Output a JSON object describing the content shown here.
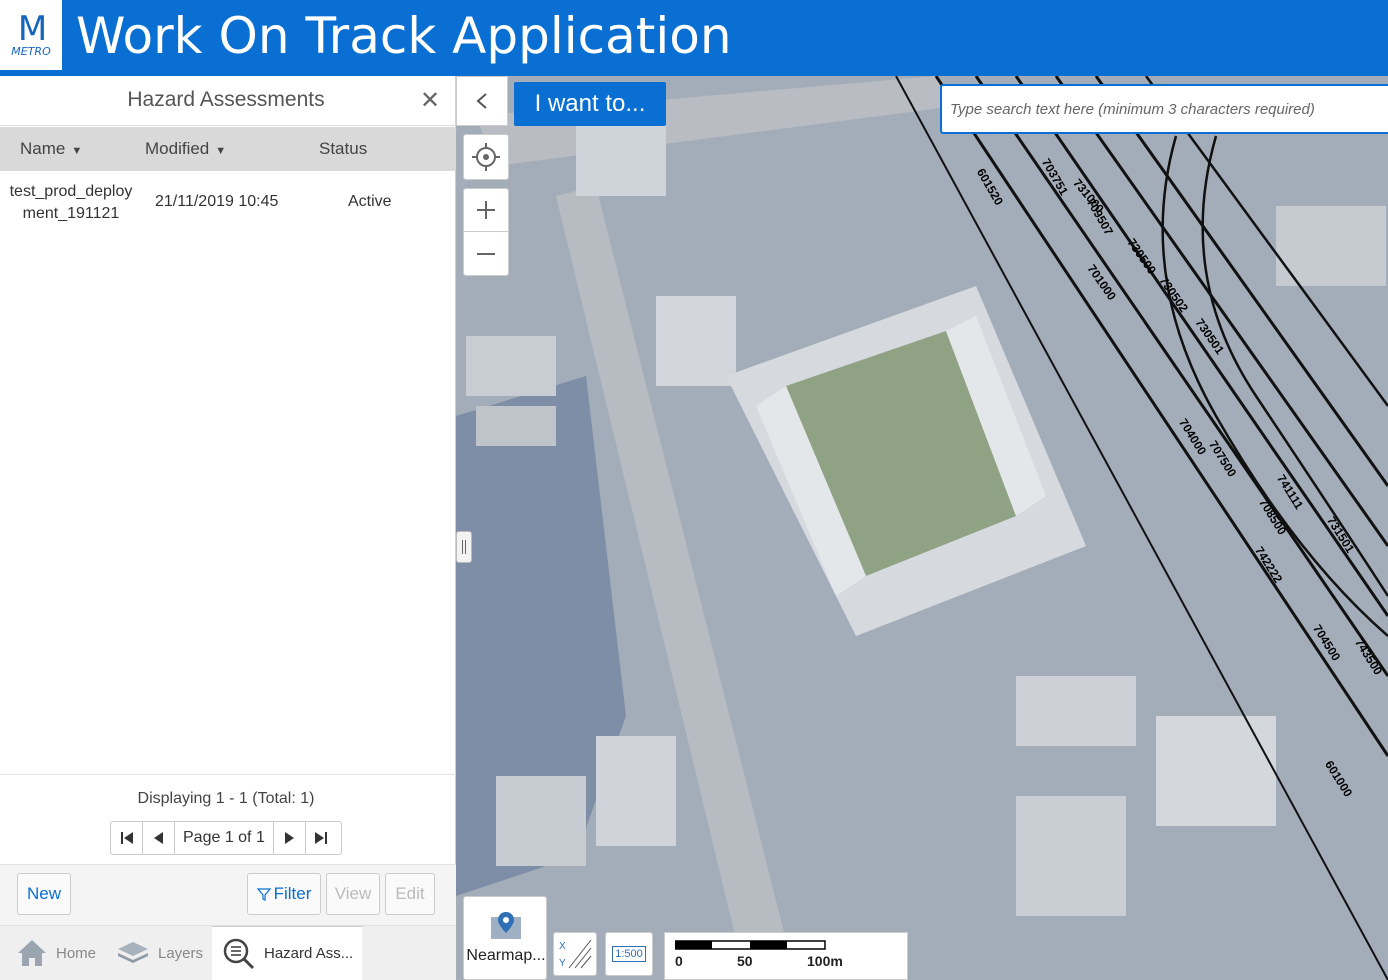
{
  "header": {
    "logo_text": "METRO",
    "title": "Work On Track Application"
  },
  "panel": {
    "title": "Hazard Assessments",
    "columns": [
      {
        "label": "Name"
      },
      {
        "label": "Modified"
      },
      {
        "label": "Status"
      }
    ],
    "rows": [
      {
        "name_line1": "test_prod_deploy",
        "name_line2": "ment_191121",
        "modified": "21/11/2019 10:45",
        "status": "Active"
      }
    ],
    "display_text": "Displaying 1 - 1 (Total: 1)",
    "page_text": "Page 1 of 1",
    "buttons": {
      "new": "New",
      "filter": "Filter",
      "view": "View",
      "edit": "Edit"
    }
  },
  "tabs": [
    {
      "label": "Home"
    },
    {
      "label": "Layers"
    },
    {
      "label": "Hazard Ass..."
    }
  ],
  "map": {
    "want_label": "I want to...",
    "search_placeholder": "Type search text here (minimum 3 characters required)",
    "nearmap_label": "Nearmap...",
    "scale_ratio": "1:500",
    "scale_labels": [
      "0",
      "50",
      "100m"
    ],
    "track_labels": [
      "601520",
      "703751",
      "709507",
      "731000",
      "730500",
      "730502",
      "730501",
      "701000",
      "704000",
      "707500",
      "741111",
      "708500",
      "742222",
      "731501",
      "704500",
      "743500",
      "601000"
    ]
  },
  "colors": {
    "brand": "#0a6fd3",
    "header_bg": "#0a6fd3"
  }
}
